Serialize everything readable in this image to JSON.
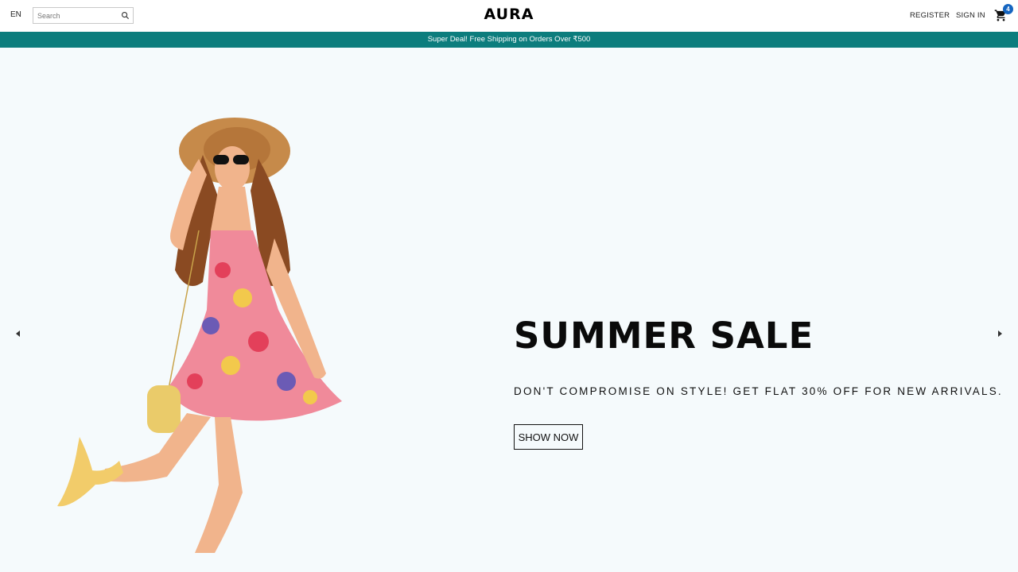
{
  "header": {
    "language": "EN",
    "search_placeholder": "Search",
    "logo": "AURA",
    "register_label": "REGISTER",
    "signin_label": "SIGN IN",
    "cart_count": "4"
  },
  "announcement": {
    "text": "Super Deal! Free Shipping on Orders Over ₹500"
  },
  "hero": {
    "title": "SUMMER SALE",
    "description": "DON'T COMPROMISE ON STYLE! GET FLAT 30% OFF FOR NEW ARRIVALS.",
    "button_label": "SHOW NOW"
  },
  "icons": {
    "search": "search-icon",
    "cart": "cart-icon",
    "prev": "arrow-left-icon",
    "next": "arrow-right-icon"
  },
  "colors": {
    "announcement_bg": "#0c7d7d",
    "hero_bg": "#f5fafc",
    "badge_bg": "#1565c0"
  }
}
